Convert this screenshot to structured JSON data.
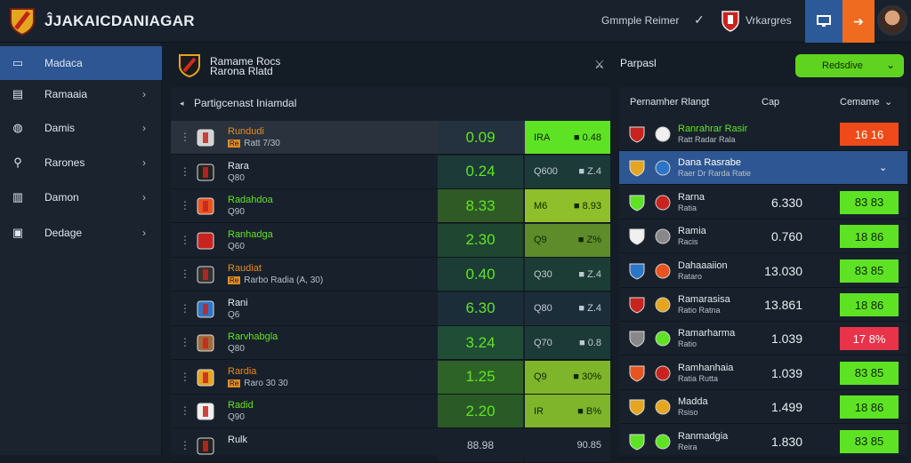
{
  "header": {
    "app_title": "ĴJAKAICDANIAGAR",
    "link": "Gmmple Reimer",
    "user": "Vrkargres"
  },
  "sidebar": {
    "items": [
      {
        "label": "Madaca",
        "icon": "monitor-icon",
        "active": true
      },
      {
        "label": "Ramaaia",
        "icon": "document-icon"
      },
      {
        "label": "Damis",
        "icon": "dial-icon"
      },
      {
        "label": "Rarones",
        "icon": "search-person-icon"
      },
      {
        "label": "Damon",
        "icon": "building-icon"
      },
      {
        "label": "Dedage",
        "icon": "calendar-icon"
      }
    ]
  },
  "match_header": {
    "line1": "Ramame Rocs",
    "line2": "Rarona Rlatd",
    "right_title": "Parpasl",
    "filter_label": "Redsdive"
  },
  "list": {
    "section_label": "Partigcenast Iniamdal",
    "rows": [
      {
        "name": "Rundudi",
        "tag": "Re",
        "sub": "Ratt 7/30",
        "score": "0.09",
        "odds_a": "IRA",
        "odds_b": "■ 0.48",
        "score_bg": "#243240",
        "odds_bg": "#5ee324",
        "name_color": "#e68a1e",
        "highlight": true
      },
      {
        "name": "Rara",
        "tag": "",
        "sub": "Q80",
        "score": "0.24",
        "odds_a": "Q600",
        "odds_b": "■ Z.4",
        "score_bg": "#1c3a38",
        "odds_bg": "#1c3a38",
        "name_color": "#e4e9ef"
      },
      {
        "name": "Radahdoa",
        "tag": "",
        "sub": "Q90",
        "score": "8.33",
        "odds_a": "M6",
        "odds_b": "■ 8.93",
        "score_bg": "#2f5a25",
        "odds_bg": "#8fbf2a",
        "name_color": "#61e324"
      },
      {
        "name": "Ranhadga",
        "tag": "",
        "sub": "Q60",
        "score": "2.30",
        "odds_a": "Q9",
        "odds_b": "■ Z%",
        "score_bg": "#1f4630",
        "odds_bg": "#5e8c2a",
        "name_color": "#61e324"
      },
      {
        "name": "Raudiat",
        "tag": "Re",
        "sub": "Rarbo Radia (A, 30)",
        "score": "0.40",
        "odds_a": "Q30",
        "odds_b": "■ Z.4",
        "score_bg": "#1c3d36",
        "odds_bg": "#1c3d36",
        "name_color": "#e68a1e"
      },
      {
        "name": "Rani",
        "tag": "",
        "sub": "Q6",
        "score": "6.30",
        "odds_a": "Q80",
        "odds_b": "■ Z.4",
        "score_bg": "#1c2d3a",
        "odds_bg": "#1c2d3a",
        "name_color": "#e4e9ef"
      },
      {
        "name": "Rarvhabgla",
        "tag": "",
        "sub": "Q80",
        "score": "3.24",
        "odds_a": "Q70",
        "odds_b": "■ 0.8",
        "score_bg": "#1f4d36",
        "odds_bg": "#1c3a38",
        "name_color": "#61e324"
      },
      {
        "name": "Rardia",
        "tag": "Re",
        "sub": "Raro 30 30",
        "score": "1.25",
        "odds_a": "Q9",
        "odds_b": "■ 30%",
        "score_bg": "#2d6327",
        "odds_bg": "#7fb52a",
        "name_color": "#e68a1e"
      },
      {
        "name": "Radid",
        "tag": "",
        "sub": "Q90",
        "score": "2.20",
        "odds_a": "IR",
        "odds_b": "■ B%",
        "score_bg": "#2a5a26",
        "odds_bg": "#7fb52a",
        "name_color": "#61e324"
      },
      {
        "name": "Rulk",
        "tag": "",
        "sub": "",
        "score": "88.98",
        "odds_a": "",
        "odds_b": "90.85",
        "score_bg": "#18212b",
        "odds_bg": "#18212b",
        "name_color": "#e4e9ef"
      }
    ]
  },
  "ranking": {
    "col_a": "Pernamher Rlangt",
    "col_b": "Cap",
    "col_c": "Cemame",
    "rows": [
      {
        "name": "Ranrahrar Rasir",
        "sub": "Ratt Radar Rala",
        "value": "",
        "pill": "16 16",
        "pill_bg": "#ee4a1a",
        "name_color": "#61e324"
      },
      {
        "name": "Dana Rasrabe",
        "sub": "Raer Dr Rarda Ratie",
        "value": "",
        "pill": "",
        "pill_bg": "",
        "selected": true
      },
      {
        "name": "Rarna",
        "sub": "Ratia",
        "value": "6.330",
        "pill": "83 83",
        "pill_bg": "#5ee324"
      },
      {
        "name": "Ramia",
        "sub": "Racis",
        "value": "0.760",
        "pill": "18 86",
        "pill_bg": "#5ee324"
      },
      {
        "name": "Dahaaaiion",
        "sub": "Rataro",
        "value": "13.030",
        "pill": "83 85",
        "pill_bg": "#5ee324"
      },
      {
        "name": "Ramarasisa",
        "sub": "Ratio Ratna",
        "value": "13.861",
        "pill": "18 86",
        "pill_bg": "#5ee324"
      },
      {
        "name": "Ramarharma",
        "sub": "Ratio",
        "value": "1.039",
        "pill": "17 8%",
        "pill_bg": "#e8334a"
      },
      {
        "name": "Ramhanhaia",
        "sub": "Ratia Rutta",
        "value": "1.039",
        "pill": "83 85",
        "pill_bg": "#5ee324"
      },
      {
        "name": "Madda",
        "sub": "Rsiso",
        "value": "1.499",
        "pill": "18 86",
        "pill_bg": "#5ee324"
      },
      {
        "name": "Ranmadgia",
        "sub": "Reira",
        "value": "1.830",
        "pill": "83 85",
        "pill_bg": "#5ee324"
      }
    ]
  }
}
